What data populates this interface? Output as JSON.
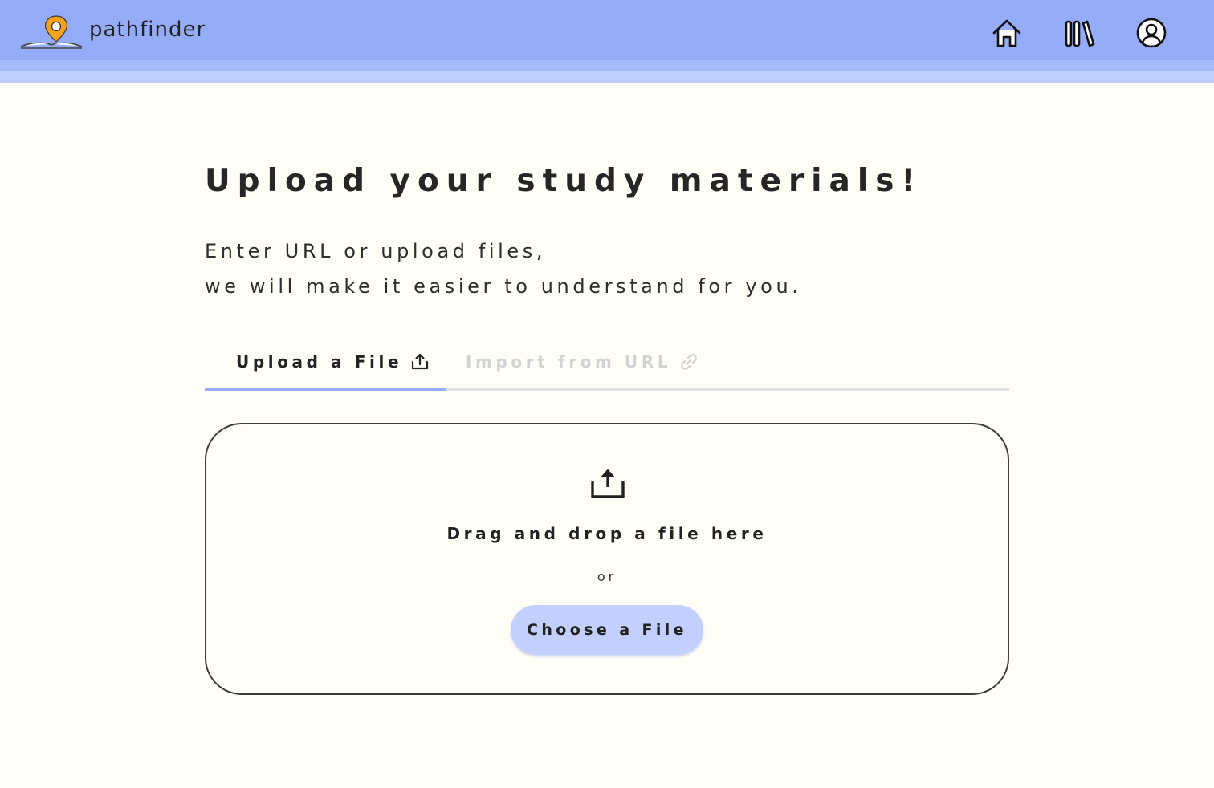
{
  "header": {
    "brand": "pathfinder",
    "nav": [
      {
        "icon": "home-icon"
      },
      {
        "icon": "library-icon"
      },
      {
        "icon": "user-profile-icon"
      }
    ],
    "colors": {
      "bar": "#95adf8",
      "accent": "#f7a21b"
    }
  },
  "main": {
    "title": "Upload your study materials!",
    "subtitle_line1": "Enter URL or upload files,",
    "subtitle_line2": "we will make it easier to understand for you.",
    "tabs": [
      {
        "label": "Upload a File",
        "icon": "upload-icon",
        "active": true
      },
      {
        "label": "Import from URL",
        "icon": "link-icon",
        "active": false
      }
    ],
    "dropzone": {
      "icon": "upload-icon",
      "title": "Drag and drop a file here",
      "or": "or",
      "button_label": "Choose a File"
    }
  }
}
